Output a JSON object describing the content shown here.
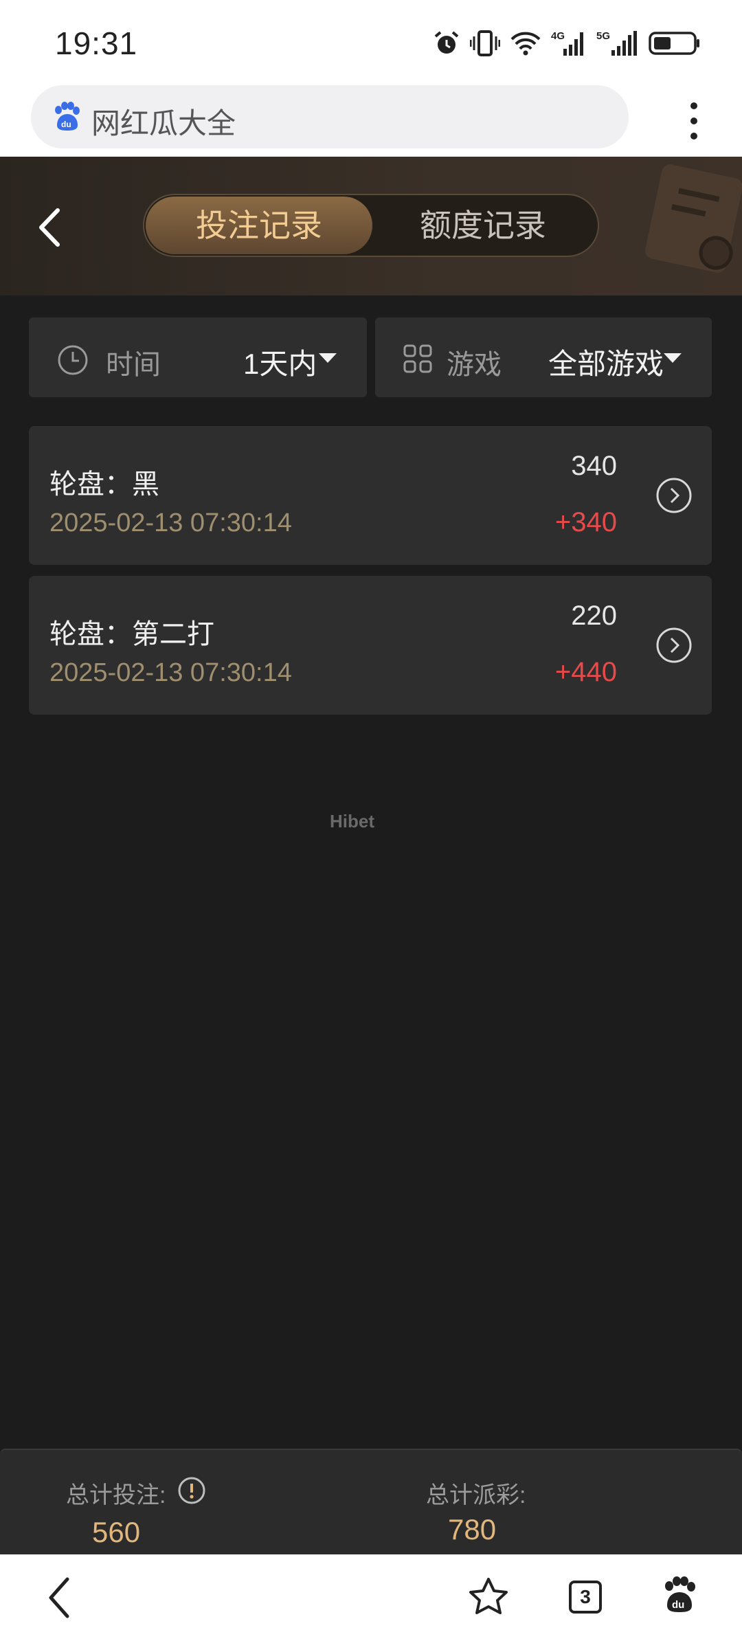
{
  "status_bar": {
    "time": "19:31",
    "icons": [
      "alarm-icon",
      "vibrate-icon",
      "wifi-icon",
      "signal-4g-icon",
      "signal-5g-icon",
      "battery-icon"
    ]
  },
  "browser": {
    "url_text": "网红瓜大全",
    "logo": "baidu-paw-icon",
    "menu": "more-vert-icon"
  },
  "header": {
    "tabs": [
      {
        "label": "投注记录",
        "active": true
      },
      {
        "label": "额度记录",
        "active": false
      }
    ],
    "accent": "#f3cc94"
  },
  "filters": {
    "time": {
      "label": "时间",
      "value": "1天内",
      "icon": "clock-icon"
    },
    "game": {
      "label": "游戏",
      "value": "全部游戏",
      "icon": "grid-icon"
    }
  },
  "records": [
    {
      "title": "轮盘：黑",
      "time": "2025-02-13 07:30:14",
      "bet": "340",
      "win": "+340"
    },
    {
      "title": "轮盘：第二打",
      "time": "2025-02-13 07:30:14",
      "bet": "220",
      "win": "+440"
    }
  ],
  "watermark": "Hibet",
  "summary": {
    "total_bet_label": "总计投注:",
    "total_bet_value": "560",
    "total_payout_label": "总计派彩:",
    "total_payout_value": "780"
  },
  "bottom_nav": {
    "tab_count": "3"
  },
  "colors": {
    "win": "#e64a4a",
    "gold": "#e2b77c",
    "bg": "#1c1c1c",
    "card": "#2e2e2e"
  }
}
